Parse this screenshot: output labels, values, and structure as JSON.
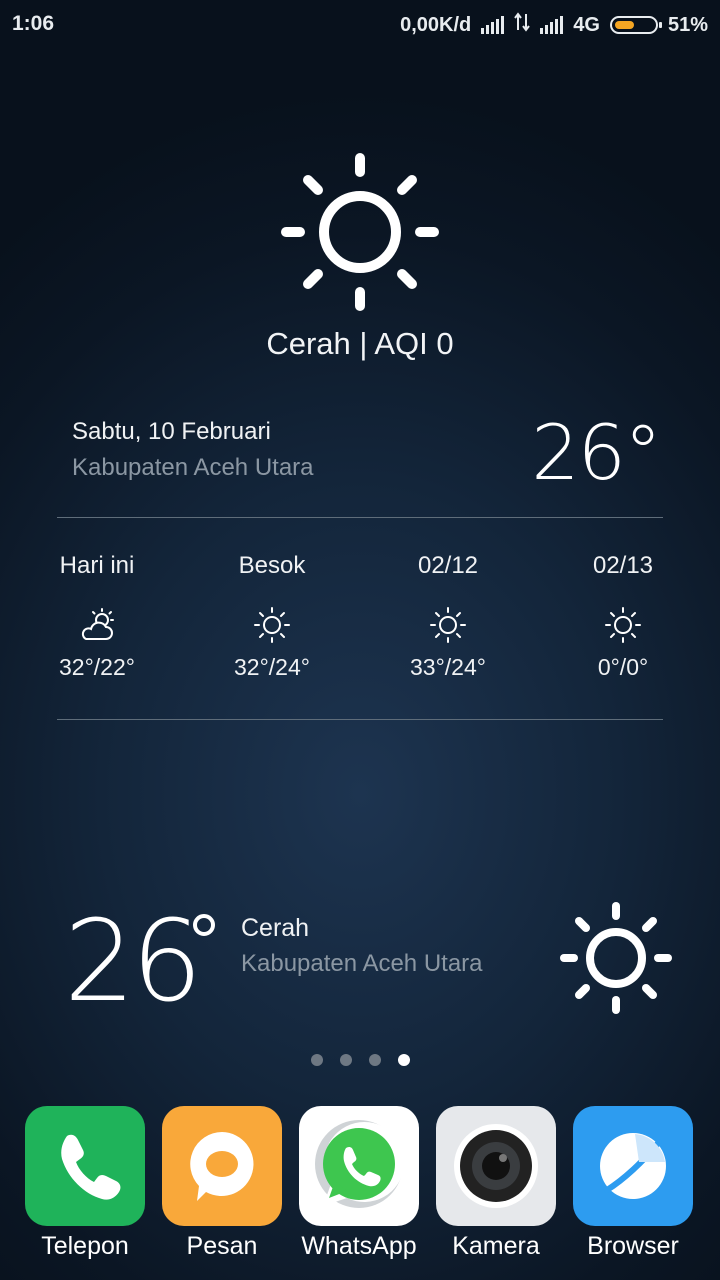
{
  "status_bar": {
    "time": "1:06",
    "speed": "0,00K/d",
    "network": "4G",
    "battery_level": 0.51,
    "battery_text": "51%"
  },
  "weather": {
    "condition_aqi": "Cerah | AQI 0",
    "date": "Sabtu, 10 Februari",
    "location": "Kabupaten Aceh Utara",
    "temperature": "26°",
    "icon": "sun-icon",
    "forecast": [
      {
        "day": "Hari ini",
        "icon": "partly-cloudy-icon",
        "range": "32°/22°"
      },
      {
        "day": "Besok",
        "icon": "sun-icon",
        "range": "32°/24°"
      },
      {
        "day": "02/12",
        "icon": "sun-icon",
        "range": "33°/24°"
      },
      {
        "day": "02/13",
        "icon": "sun-icon",
        "range": "0°/0°"
      }
    ]
  },
  "widget": {
    "temperature": "26",
    "condition": "Cerah",
    "location": "Kabupaten Aceh Utara",
    "icon": "sun-icon"
  },
  "pages": {
    "count": 4,
    "active": 4
  },
  "dock": [
    {
      "label": "Telepon",
      "icon": "phone-icon",
      "color": "#1fb35a"
    },
    {
      "label": "Pesan",
      "icon": "message-icon",
      "color": "#f9a83a"
    },
    {
      "label": "WhatsApp",
      "icon": "whatsapp-icon",
      "color": "#ffffff"
    },
    {
      "label": "Kamera",
      "icon": "camera-icon",
      "color": "#e6e8eb"
    },
    {
      "label": "Browser",
      "icon": "browser-icon",
      "color": "#2d9cf0"
    }
  ]
}
